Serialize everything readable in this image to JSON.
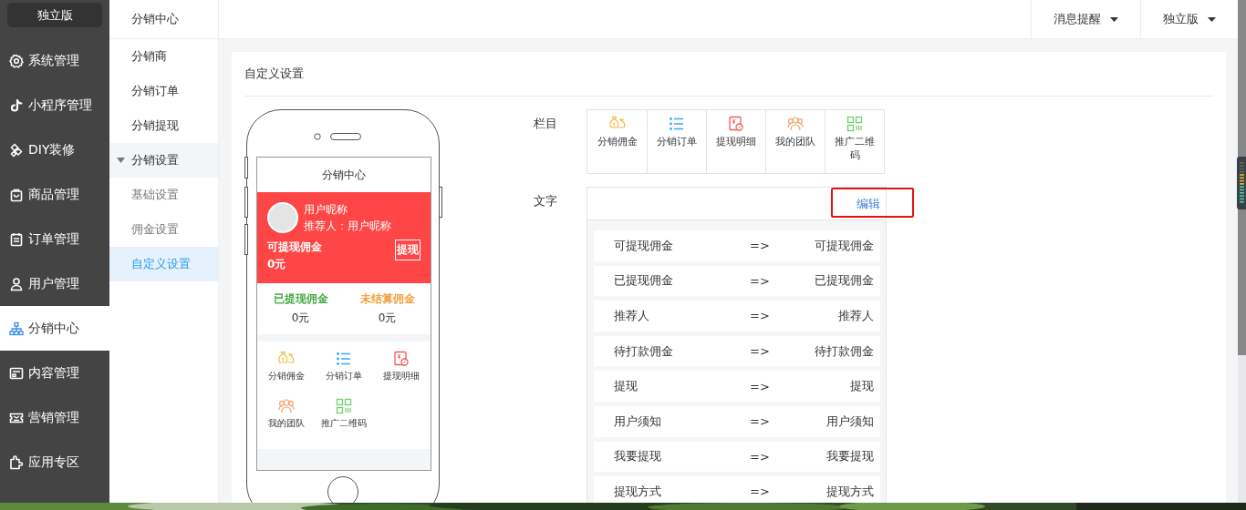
{
  "sidebar": {
    "edition": "独立版",
    "items": [
      {
        "label": "系统管理",
        "selected": false
      },
      {
        "label": "小程序管理",
        "selected": false
      },
      {
        "label": "DIY装修",
        "selected": false
      },
      {
        "label": "商品管理",
        "selected": false
      },
      {
        "label": "订单管理",
        "selected": false
      },
      {
        "label": "用户管理",
        "selected": false
      },
      {
        "label": "分销中心",
        "selected": true
      },
      {
        "label": "内容管理",
        "selected": false
      },
      {
        "label": "营销管理",
        "selected": false
      },
      {
        "label": "应用专区",
        "selected": false
      }
    ]
  },
  "submenu": {
    "title": "分销中心",
    "items": [
      {
        "kind": "link",
        "label": "分销商",
        "selected": false
      },
      {
        "kind": "link",
        "label": "分销订单",
        "selected": false
      },
      {
        "kind": "link",
        "label": "分销提现",
        "selected": false
      },
      {
        "kind": "group",
        "label": "分销设置",
        "expanded": true,
        "children": [
          {
            "label": "基础设置",
            "selected": false
          },
          {
            "label": "佣金设置",
            "selected": false
          },
          {
            "label": "自定义设置",
            "selected": true
          }
        ]
      }
    ]
  },
  "header": {
    "menus": [
      {
        "label": "消息提醒"
      },
      {
        "label": "独立版"
      }
    ]
  },
  "card": {
    "title": "自定义设置"
  },
  "phone": {
    "title": "分销中心",
    "nickname": "用户昵称",
    "referrer": "推荐人：用户昵称",
    "balance_label": "可提现佣金",
    "balance": "0元",
    "withdraw_button": "提现",
    "stats": [
      {
        "label": "已提现佣金",
        "value": "0元",
        "color": "#3ba33a"
      },
      {
        "label": "未结算佣金",
        "value": "0元",
        "color": "#f39a36"
      }
    ],
    "entries": [
      {
        "label": "分销佣金"
      },
      {
        "label": "分销订单"
      },
      {
        "label": "提现明细"
      },
      {
        "label": "我的团队"
      },
      {
        "label": "推广二维码"
      }
    ]
  },
  "columns": {
    "label": "栏目",
    "entries": [
      {
        "label": "分销佣金"
      },
      {
        "label": "分销订单"
      },
      {
        "label": "提现明细"
      },
      {
        "label": "我的团队"
      },
      {
        "label": "推广二维码"
      }
    ]
  },
  "texts": {
    "label": "文字",
    "edit_link": "编辑",
    "rows": [
      {
        "original": "可提现佣金",
        "arrow": "=>",
        "custom": "可提现佣金"
      },
      {
        "original": "已提现佣金",
        "arrow": "=>",
        "custom": "已提现佣金"
      },
      {
        "original": "推荐人",
        "arrow": "=>",
        "custom": "推荐人"
      },
      {
        "original": "待打款佣金",
        "arrow": "=>",
        "custom": "待打款佣金"
      },
      {
        "original": "提现",
        "arrow": "=>",
        "custom": "提现"
      },
      {
        "original": "用户须知",
        "arrow": "=>",
        "custom": "用户须知"
      },
      {
        "original": "我要提现",
        "arrow": "=>",
        "custom": "我要提现"
      },
      {
        "original": "提现方式",
        "arrow": "=>",
        "custom": "提现方式"
      }
    ]
  }
}
